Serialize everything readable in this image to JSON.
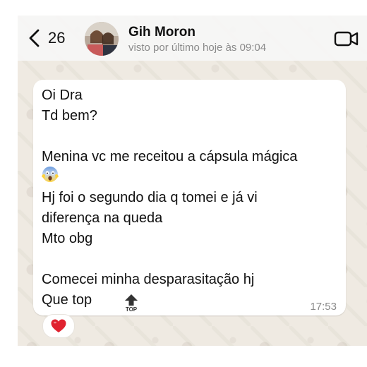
{
  "header": {
    "back_count": "26",
    "contact_name": "Gih Moron",
    "last_seen": "visto por último hoje às 09:04"
  },
  "message": {
    "lines": [
      "Oi Dra",
      "Td bem?",
      "Menina vc me receitou a cápsula mágica",
      "Hj foi o segundo dia q tomei e já vi",
      "diferença na queda",
      "Mto obg",
      "Comecei minha desparasitação hj",
      "Que top"
    ],
    "emoji_top_label": "TOP",
    "time": "17:53",
    "reaction": "heart"
  },
  "colors": {
    "chat_background": "#efeae2",
    "bubble": "#ffffff",
    "header": "#f6f6f6",
    "reaction_heart": "#e0222f"
  },
  "icons": [
    "chevron-left-icon",
    "video-call-icon",
    "screaming-face-emoji",
    "top-arrow-emoji",
    "heart-reaction-icon"
  ]
}
